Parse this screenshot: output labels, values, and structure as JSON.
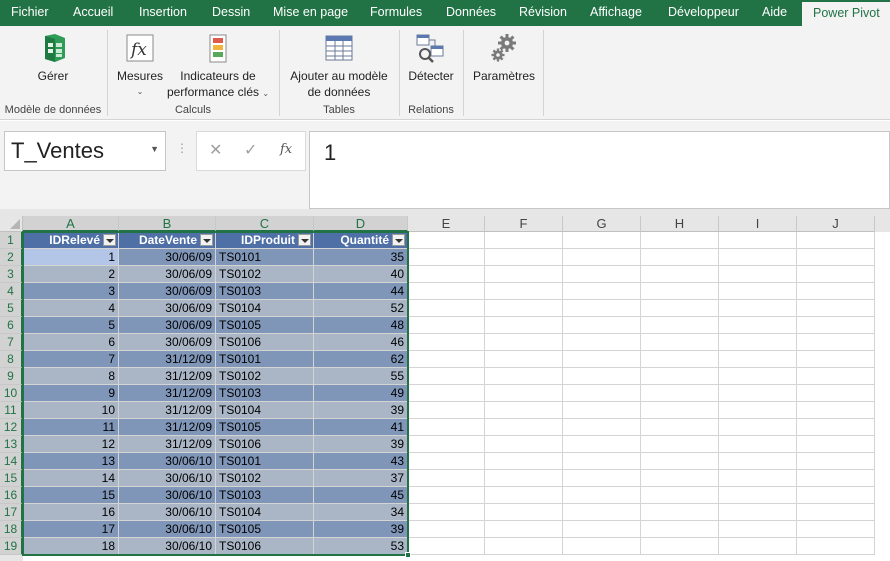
{
  "menu": {
    "tabs": [
      {
        "label": "Fichier"
      },
      {
        "label": "Accueil"
      },
      {
        "label": "Insertion"
      },
      {
        "label": "Dessin"
      },
      {
        "label": "Mise en page"
      },
      {
        "label": "Formules"
      },
      {
        "label": "Données"
      },
      {
        "label": "Révision"
      },
      {
        "label": "Affichage"
      },
      {
        "label": "Développeur"
      },
      {
        "label": "Aide"
      },
      {
        "label": "Power Pivot"
      }
    ],
    "active": "Power Pivot"
  },
  "ribbon": {
    "groups": {
      "data_model": "Modèle de données",
      "calculations": "Calculs",
      "tables": "Tables",
      "relations": "Relations"
    },
    "buttons": {
      "manage": "Gérer",
      "measures": "Mesures",
      "kpi_line1": "Indicateurs de",
      "kpi_line2": "performance clés",
      "add_model_line1": "Ajouter au modèle",
      "add_model_line2": "de données",
      "detect": "Détecter",
      "settings": "Paramètres"
    },
    "icons": {
      "manage": "power-pivot-manage-icon",
      "measures": "fx-measures-icon",
      "kpi": "kpi-traffic-light-icon",
      "add_model": "table-add-icon",
      "detect": "detect-relations-icon",
      "settings": "gears-icon"
    },
    "accent": "#217346"
  },
  "formula_bar": {
    "name_box": "T_Ventes",
    "cancel_glyph": "✕",
    "confirm_glyph": "✓",
    "fx_glyph": "fx",
    "value": "1"
  },
  "grid": {
    "columns": [
      "A",
      "B",
      "C",
      "D",
      "E",
      "F",
      "G",
      "H",
      "I",
      "J"
    ],
    "rows": [
      "1",
      "2",
      "3",
      "4",
      "5",
      "6",
      "7",
      "8",
      "9",
      "10",
      "11",
      "12",
      "13",
      "14",
      "15",
      "16",
      "17",
      "18",
      "19"
    ],
    "table": {
      "name": "T_Ventes",
      "headers": [
        "IDRelevé",
        "DateVente",
        "IDProduit",
        "Quantité"
      ],
      "rows": [
        [
          "1",
          "30/06/09",
          "TS0101",
          "35"
        ],
        [
          "2",
          "30/06/09",
          "TS0102",
          "40"
        ],
        [
          "3",
          "30/06/09",
          "TS0103",
          "44"
        ],
        [
          "4",
          "30/06/09",
          "TS0104",
          "52"
        ],
        [
          "5",
          "30/06/09",
          "TS0105",
          "48"
        ],
        [
          "6",
          "30/06/09",
          "TS0106",
          "46"
        ],
        [
          "7",
          "31/12/09",
          "TS0101",
          "62"
        ],
        [
          "8",
          "31/12/09",
          "TS0102",
          "55"
        ],
        [
          "9",
          "31/12/09",
          "TS0103",
          "49"
        ],
        [
          "10",
          "31/12/09",
          "TS0104",
          "39"
        ],
        [
          "11",
          "31/12/09",
          "TS0105",
          "41"
        ],
        [
          "12",
          "31/12/09",
          "TS0106",
          "39"
        ],
        [
          "13",
          "30/06/10",
          "TS0101",
          "43"
        ],
        [
          "14",
          "30/06/10",
          "TS0102",
          "37"
        ],
        [
          "15",
          "30/06/10",
          "TS0103",
          "45"
        ],
        [
          "16",
          "30/06/10",
          "TS0104",
          "34"
        ],
        [
          "17",
          "30/06/10",
          "TS0105",
          "39"
        ],
        [
          "18",
          "30/06/10",
          "TS0106",
          "53"
        ]
      ],
      "header_color": "#4f6fa7",
      "band_dark": "#8096b8",
      "band_light": "#aab6c6"
    }
  }
}
